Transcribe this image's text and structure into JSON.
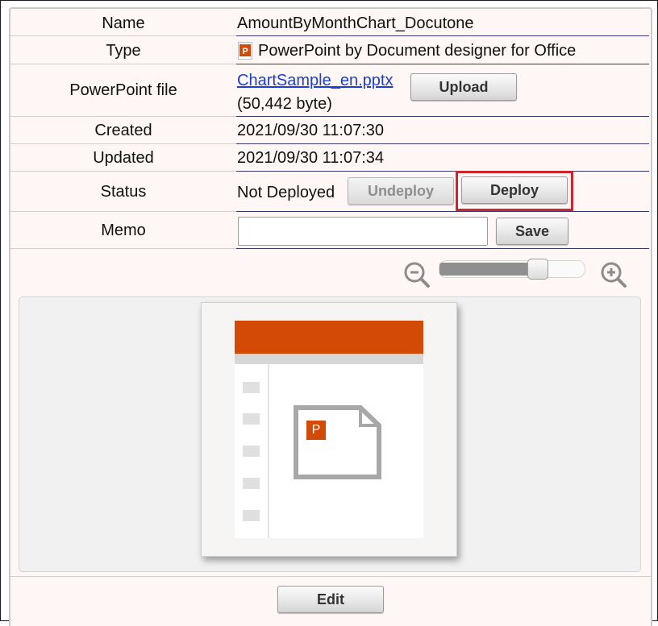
{
  "properties": {
    "name": {
      "label": "Name",
      "value": "AmountByMonthChart_Docutone"
    },
    "type": {
      "label": "Type",
      "value": "PowerPoint by Document designer for Office",
      "icon": "powerpoint-icon"
    },
    "file": {
      "label": "PowerPoint file",
      "link": "ChartSample_en.pptx",
      "size": "(50,442 byte)",
      "upload_label": "Upload"
    },
    "created": {
      "label": "Created",
      "value": "2021/09/30 11:07:30"
    },
    "updated": {
      "label": "Updated",
      "value": "2021/09/30 11:07:34"
    },
    "status": {
      "label": "Status",
      "value": "Not Deployed",
      "undeploy_label": "Undeploy",
      "deploy_label": "Deploy"
    },
    "memo": {
      "label": "Memo",
      "value": "",
      "save_label": "Save"
    }
  },
  "zoom": {
    "out_icon": "zoom-out-icon",
    "in_icon": "zoom-in-icon",
    "level": 0.7
  },
  "preview": {
    "icon_letter": "P",
    "accent": "#d24a05"
  },
  "footer": {
    "edit_label": "Edit"
  },
  "colors": {
    "panel_bg": "#fff6f6",
    "highlight": "#d0242c",
    "link": "#1a3fd9",
    "row_rule": "#38386e"
  }
}
